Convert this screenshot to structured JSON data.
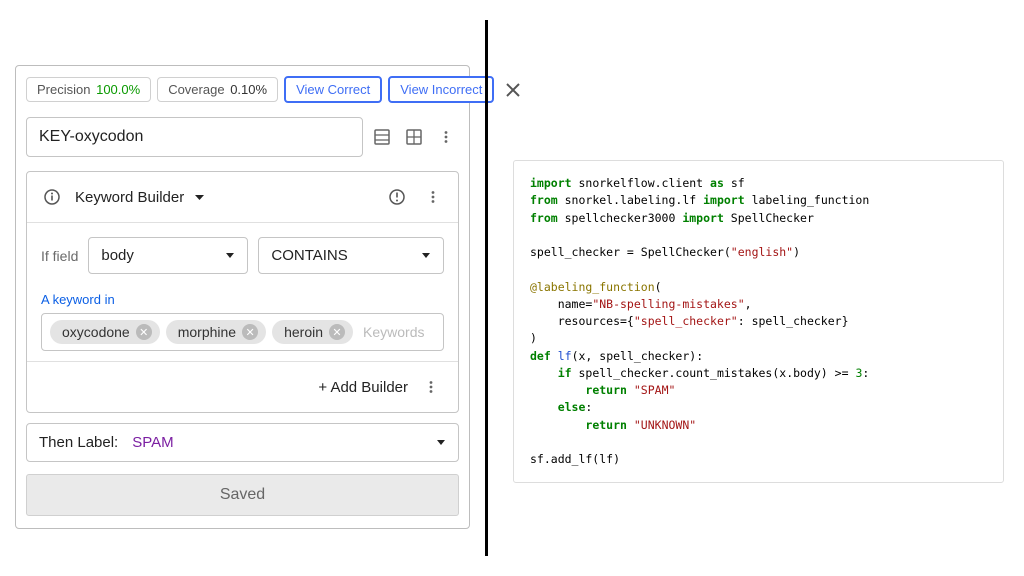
{
  "metrics": {
    "precision_label": "Precision",
    "precision_value": "100.0%",
    "coverage_label": "Coverage",
    "coverage_value": "0.10%"
  },
  "buttons": {
    "view_correct": "View Correct",
    "view_incorrect": "View Incorrect"
  },
  "lf_name": "KEY-oxycodon",
  "builder": {
    "title": "Keyword Builder",
    "if_field_label": "If field",
    "field": "body",
    "operator": "CONTAINS",
    "keyword_link": "A keyword in",
    "chips": [
      "oxycodone",
      "morphine",
      "heroin"
    ],
    "chips_placeholder": "Keywords",
    "add_builder": "+ Add Builder"
  },
  "then": {
    "label": "Then Label:",
    "value": "SPAM"
  },
  "saved_label": "Saved",
  "code": {
    "t1a": "import",
    "t1b": " snorkelflow.client ",
    "t1c": "as",
    "t1d": " sf",
    "t2a": "from",
    "t2b": " snorkel.labeling.lf ",
    "t2c": "import",
    "t2d": " labeling_function",
    "t3a": "from",
    "t3b": " spellchecker3000 ",
    "t3c": "import",
    "t3d": " SpellChecker",
    "t5a": "spell_checker = SpellChecker(",
    "t5s": "\"english\"",
    "t5b": ")",
    "t7a": "@labeling_function",
    "t7b": "(",
    "t8a": "    name=",
    "t8s": "\"NB-spelling-mistakes\"",
    "t8b": ",",
    "t9a": "    resources={",
    "t9s": "\"spell_checker\"",
    "t9b": ": spell_checker}",
    "t10": ")",
    "t11a": "def",
    "t11b": " ",
    "t11n": "lf",
    "t11c": "(x, spell_checker):",
    "t12a": "    ",
    "t12b": "if",
    "t12c": " spell_checker.count_mistakes(x.body) >= ",
    "t12n": "3",
    "t12d": ":",
    "t13a": "        ",
    "t13b": "return",
    "t13c": " ",
    "t13s": "\"SPAM\"",
    "t14a": "    ",
    "t14b": "else",
    "t14c": ":",
    "t15a": "        ",
    "t15b": "return",
    "t15c": " ",
    "t15s": "\"UNKNOWN\"",
    "t17": "sf.add_lf(lf)"
  }
}
